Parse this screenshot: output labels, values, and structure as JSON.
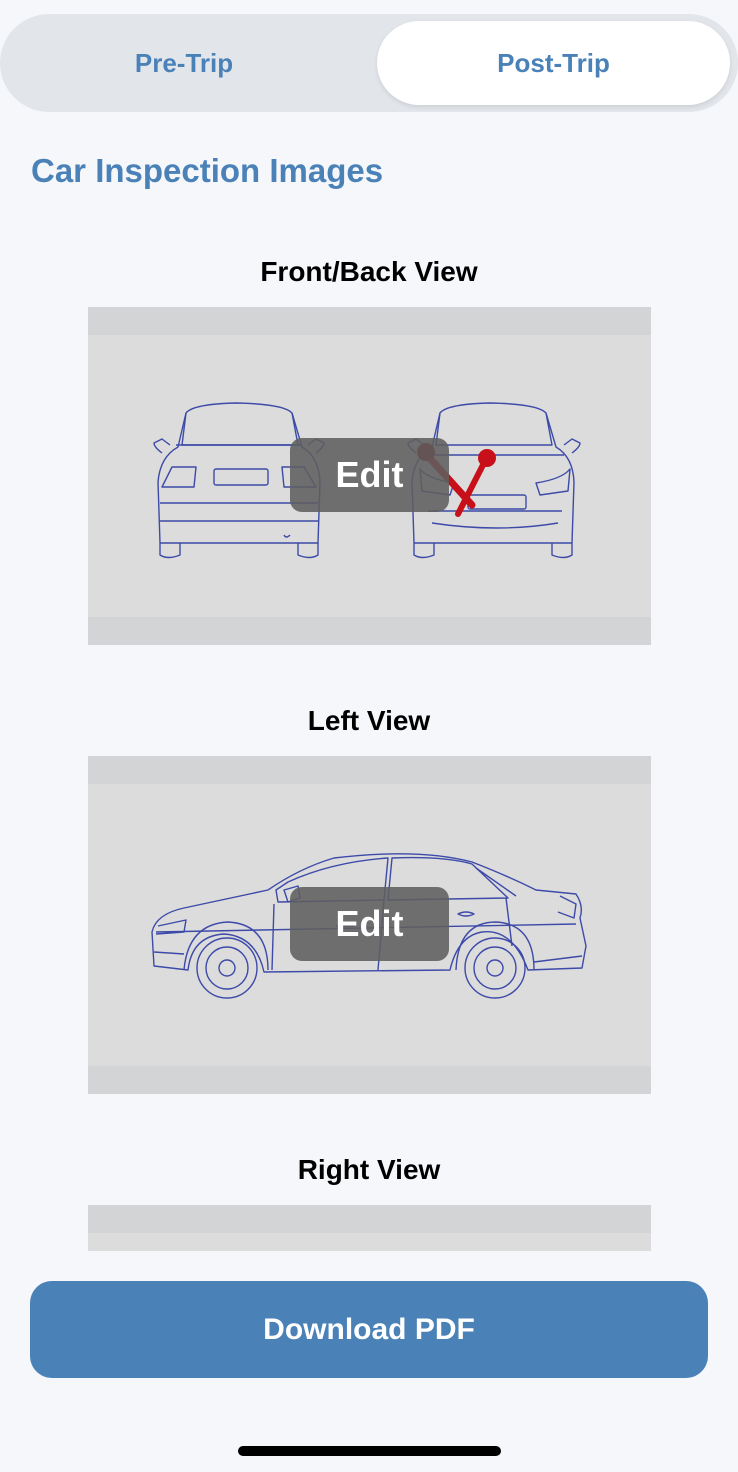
{
  "tabs": {
    "pre_trip": "Pre-Trip",
    "post_trip": "Post-Trip",
    "active": "post_trip"
  },
  "section_title": "Car Inspection Images",
  "views": [
    {
      "label": "Front/Back View",
      "edit_label": "Edit",
      "damage_marked": true
    },
    {
      "label": "Left View",
      "edit_label": "Edit",
      "damage_marked": false
    },
    {
      "label": "Right View"
    }
  ],
  "download_label": "Download PDF",
  "colors": {
    "accent": "#4a82b8",
    "car_outline": "#3d4aa8",
    "damage_mark": "#c8101a"
  }
}
